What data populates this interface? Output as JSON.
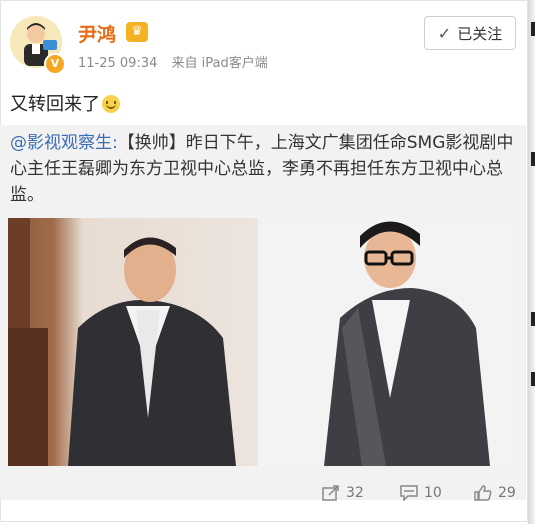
{
  "post": {
    "username": "尹鸿",
    "time": "11-25 09:34",
    "source": "来自 iPad客户端",
    "follow_label": "已关注",
    "text": "又转回来了"
  },
  "repost": {
    "mention": "@影视观察生:",
    "text": "【换帅】昨日下午，上海文广集团任命SMG影视剧中心主任王磊卿为东方卫视中心总监，李勇不再担任东方卫视中心总监。"
  },
  "actions": {
    "repost_count": "32",
    "comment_count": "10",
    "like_count": "29"
  },
  "icons": [
    "avatar-illustration",
    "verified-badge-icon",
    "crown-icon",
    "check-icon",
    "smile-emoji-icon",
    "share-icon",
    "comment-icon",
    "like-icon"
  ],
  "colors": {
    "username": "#e86b16",
    "mention": "#3c6eb4",
    "repost_bg": "#f2f2f2",
    "verified": "#f5a623"
  }
}
